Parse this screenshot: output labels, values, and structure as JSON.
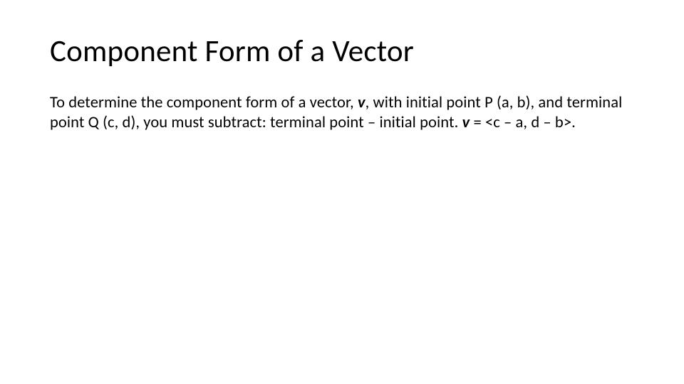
{
  "title": "Component Form of a Vector",
  "body": {
    "t1": "To determine the component form of a vector, ",
    "v1": "v",
    "t2": ", with initial point P (a, b), and terminal point Q (c, d), you must subtract: terminal point – initial point.  ",
    "v2": "v",
    "t3": " = <c – a, d – b>."
  }
}
